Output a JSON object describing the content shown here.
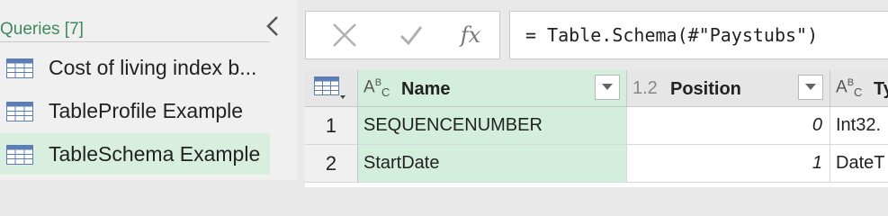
{
  "queries": {
    "header": "Queries [7]",
    "items": [
      {
        "label": "Cost of living index b..."
      },
      {
        "label": "TableProfile Example"
      },
      {
        "label": "TableSchema Example"
      }
    ]
  },
  "formula_bar": {
    "fx_label": "fx",
    "formula": "= Table.Schema(#\"Paystubs\")"
  },
  "grid": {
    "columns": [
      {
        "type": "ABC",
        "name": "Name"
      },
      {
        "type": "1.2",
        "name": "Position"
      },
      {
        "type": "ABC",
        "name": "Ty"
      }
    ],
    "rows": [
      {
        "num": "1",
        "name": "SEQUENCENUMBER",
        "position": "0",
        "type": "Int32."
      },
      {
        "num": "2",
        "name": "StartDate",
        "position": "1",
        "type": "DateT"
      }
    ]
  },
  "colors": {
    "accent_green": "#3c8a5e",
    "selected_bg": "#d4eedd"
  }
}
